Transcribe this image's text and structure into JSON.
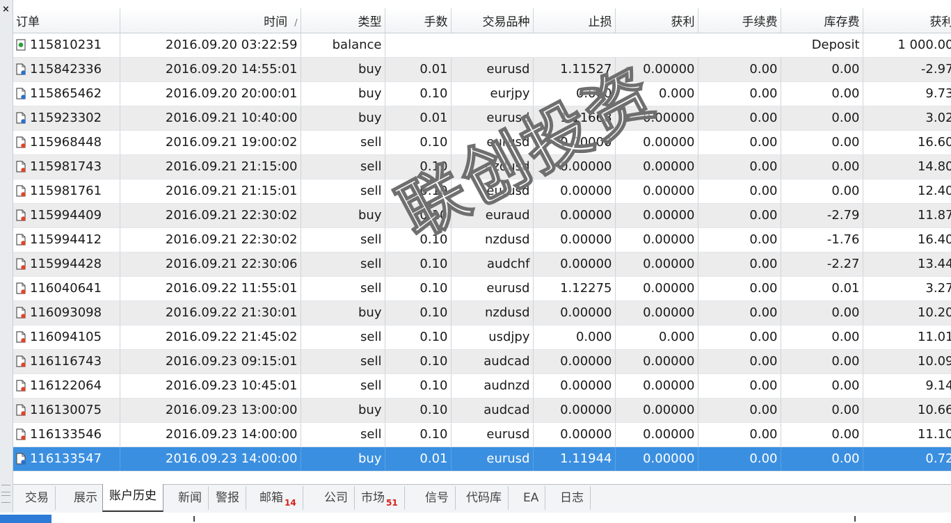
{
  "columns": [
    "订单",
    "时间",
    "类型",
    "手数",
    "交易品种",
    "止损",
    "获利",
    "手续费",
    "库存费",
    "获利"
  ],
  "sort_indicator": "/",
  "rows": [
    {
      "order": "115810231",
      "time": "2016.09.20 03:22:59",
      "type": "balance",
      "lots": "",
      "symbol": "",
      "sl": "",
      "tp": "",
      "commission": "",
      "swap": "Deposit",
      "profit": "1 000.00",
      "icon": "deposit-icon"
    },
    {
      "order": "115842336",
      "time": "2016.09.20 14:55:01",
      "type": "buy",
      "lots": "0.01",
      "symbol": "eurusd",
      "sl": "1.11527",
      "tp": "0.00000",
      "commission": "0.00",
      "swap": "0.00",
      "profit": "-2.97",
      "icon": "buy-order-icon"
    },
    {
      "order": "115865462",
      "time": "2016.09.20 20:00:01",
      "type": "buy",
      "lots": "0.10",
      "symbol": "eurjpy",
      "sl": "0.000",
      "tp": "0.000",
      "commission": "0.00",
      "swap": "0.00",
      "profit": "9.73",
      "icon": "buy-order-icon"
    },
    {
      "order": "115923302",
      "time": "2016.09.21 10:40:00",
      "type": "buy",
      "lots": "0.01",
      "symbol": "eurusd",
      "sl": "1.11668",
      "tp": "0.00000",
      "commission": "0.00",
      "swap": "0.00",
      "profit": "3.02",
      "icon": "buy-order-icon"
    },
    {
      "order": "115968448",
      "time": "2016.09.21 19:00:02",
      "type": "sell",
      "lots": "0.10",
      "symbol": "eurusd",
      "sl": "0.00000",
      "tp": "0.00000",
      "commission": "0.00",
      "swap": "0.00",
      "profit": "16.60",
      "icon": "sell-order-icon"
    },
    {
      "order": "115981743",
      "time": "2016.09.21 21:15:00",
      "type": "sell",
      "lots": "0.10",
      "symbol": "nzdusd",
      "sl": "0.00000",
      "tp": "0.00000",
      "commission": "0.00",
      "swap": "0.00",
      "profit": "14.80",
      "icon": "sell-order-icon"
    },
    {
      "order": "115981761",
      "time": "2016.09.21 21:15:01",
      "type": "sell",
      "lots": "0.10",
      "symbol": "eurusd",
      "sl": "0.00000",
      "tp": "0.00000",
      "commission": "0.00",
      "swap": "0.00",
      "profit": "12.40",
      "icon": "sell-order-icon"
    },
    {
      "order": "115994409",
      "time": "2016.09.21 22:30:02",
      "type": "buy",
      "lots": "0.10",
      "symbol": "euraud",
      "sl": "0.00000",
      "tp": "0.00000",
      "commission": "0.00",
      "swap": "-2.79",
      "profit": "11.87",
      "icon": "sell-order-icon"
    },
    {
      "order": "115994412",
      "time": "2016.09.21 22:30:02",
      "type": "sell",
      "lots": "0.10",
      "symbol": "nzdusd",
      "sl": "0.00000",
      "tp": "0.00000",
      "commission": "0.00",
      "swap": "-1.76",
      "profit": "16.40",
      "icon": "sell-order-icon"
    },
    {
      "order": "115994428",
      "time": "2016.09.21 22:30:06",
      "type": "sell",
      "lots": "0.10",
      "symbol": "audchf",
      "sl": "0.00000",
      "tp": "0.00000",
      "commission": "0.00",
      "swap": "-2.27",
      "profit": "13.44",
      "icon": "sell-order-icon"
    },
    {
      "order": "116040641",
      "time": "2016.09.22 11:55:01",
      "type": "sell",
      "lots": "0.10",
      "symbol": "eurusd",
      "sl": "1.12275",
      "tp": "0.00000",
      "commission": "0.00",
      "swap": "0.01",
      "profit": "3.27",
      "icon": "sell-order-icon"
    },
    {
      "order": "116093098",
      "time": "2016.09.22 21:30:01",
      "type": "buy",
      "lots": "0.10",
      "symbol": "nzdusd",
      "sl": "0.00000",
      "tp": "0.00000",
      "commission": "0.00",
      "swap": "0.00",
      "profit": "10.20",
      "icon": "sell-order-icon"
    },
    {
      "order": "116094105",
      "time": "2016.09.22 21:45:02",
      "type": "sell",
      "lots": "0.10",
      "symbol": "usdjpy",
      "sl": "0.000",
      "tp": "0.000",
      "commission": "0.00",
      "swap": "0.00",
      "profit": "11.01",
      "icon": "sell-order-icon"
    },
    {
      "order": "116116743",
      "time": "2016.09.23 09:15:01",
      "type": "sell",
      "lots": "0.10",
      "symbol": "audcad",
      "sl": "0.00000",
      "tp": "0.00000",
      "commission": "0.00",
      "swap": "0.00",
      "profit": "10.09",
      "icon": "sell-order-icon"
    },
    {
      "order": "116122064",
      "time": "2016.09.23 10:45:01",
      "type": "sell",
      "lots": "0.10",
      "symbol": "audnzd",
      "sl": "0.00000",
      "tp": "0.00000",
      "commission": "0.00",
      "swap": "0.00",
      "profit": "9.14",
      "icon": "sell-order-icon"
    },
    {
      "order": "116130075",
      "time": "2016.09.23 13:00:00",
      "type": "buy",
      "lots": "0.10",
      "symbol": "audcad",
      "sl": "0.00000",
      "tp": "0.00000",
      "commission": "0.00",
      "swap": "0.00",
      "profit": "10.66",
      "icon": "sell-order-icon"
    },
    {
      "order": "116133546",
      "time": "2016.09.23 14:00:00",
      "type": "sell",
      "lots": "0.10",
      "symbol": "eurusd",
      "sl": "0.00000",
      "tp": "0.00000",
      "commission": "0.00",
      "swap": "0.00",
      "profit": "11.10",
      "icon": "sell-order-icon"
    },
    {
      "order": "116133547",
      "time": "2016.09.23 14:00:00",
      "type": "buy",
      "lots": "0.01",
      "symbol": "eurusd",
      "sl": "1.11944",
      "tp": "0.00000",
      "commission": "0.00",
      "swap": "0.00",
      "profit": "0.72",
      "icon": "buy-order-icon"
    }
  ],
  "selected_order": "116133547",
  "tabs": [
    {
      "label": "交易",
      "badge": ""
    },
    {
      "label": "展示",
      "badge": ""
    },
    {
      "label": "账户历史",
      "badge": ""
    },
    {
      "label": "新闻",
      "badge": ""
    },
    {
      "label": "警报",
      "badge": ""
    },
    {
      "label": "邮箱",
      "badge": "14"
    },
    {
      "label": "公司",
      "badge": ""
    },
    {
      "label": "市场",
      "badge": "51"
    },
    {
      "label": "信号",
      "badge": ""
    },
    {
      "label": "代码库",
      "badge": ""
    },
    {
      "label": "EA",
      "badge": ""
    },
    {
      "label": "日志",
      "badge": ""
    }
  ],
  "active_tab": "账户历史",
  "watermark": "联创投资",
  "colors": {
    "selection": "#3b8fe0",
    "badge": "#d8201a",
    "alt_row": "#ececec",
    "buy_icon": "#2a6fd0",
    "sell_icon": "#e0452a",
    "deposit_icon": "#2e9e3a"
  }
}
